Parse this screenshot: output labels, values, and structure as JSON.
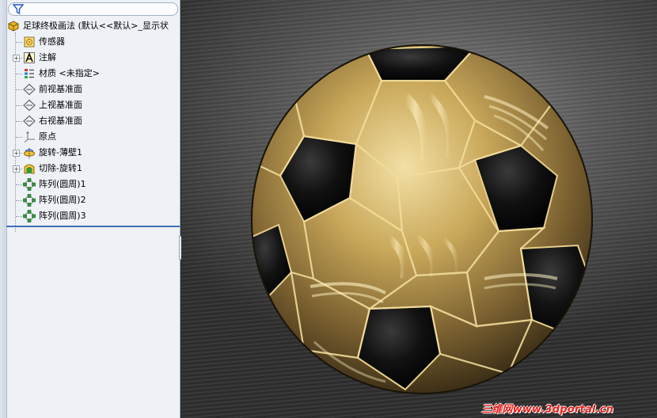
{
  "tree": {
    "root": {
      "label": "足球终极画法 (默认<<默认>_显示状",
      "icon": "part-icon"
    },
    "items": [
      {
        "label": "传感器",
        "icon": "sensor-icon",
        "expandable": false
      },
      {
        "label": "注解",
        "icon": "annotation-icon",
        "expandable": true
      },
      {
        "label": "材质 <未指定>",
        "icon": "material-icon",
        "expandable": false
      },
      {
        "label": "前视基准面",
        "icon": "plane-icon",
        "expandable": false
      },
      {
        "label": "上视基准面",
        "icon": "plane-icon",
        "expandable": false
      },
      {
        "label": "右视基准面",
        "icon": "plane-icon",
        "expandable": false
      },
      {
        "label": "原点",
        "icon": "origin-icon",
        "expandable": false
      },
      {
        "label": "旋转-薄壁1",
        "icon": "revolve-icon",
        "expandable": true
      },
      {
        "label": "切除-旋转1",
        "icon": "cut-revolve-icon",
        "expandable": true
      },
      {
        "label": "阵列(圆周)1",
        "icon": "circular-pattern-icon",
        "expandable": false
      },
      {
        "label": "阵列(圆周)2",
        "icon": "circular-pattern-icon",
        "expandable": false
      },
      {
        "label": "阵列(圆周)3",
        "icon": "circular-pattern-icon",
        "expandable": false
      }
    ]
  },
  "viewport": {
    "model": "soccer-ball-model",
    "colors": {
      "gold": "#c9a85a",
      "black": "#0a0a0a",
      "background": "#5b5b5b"
    }
  },
  "watermark": "三维网www.3dportal.cn"
}
